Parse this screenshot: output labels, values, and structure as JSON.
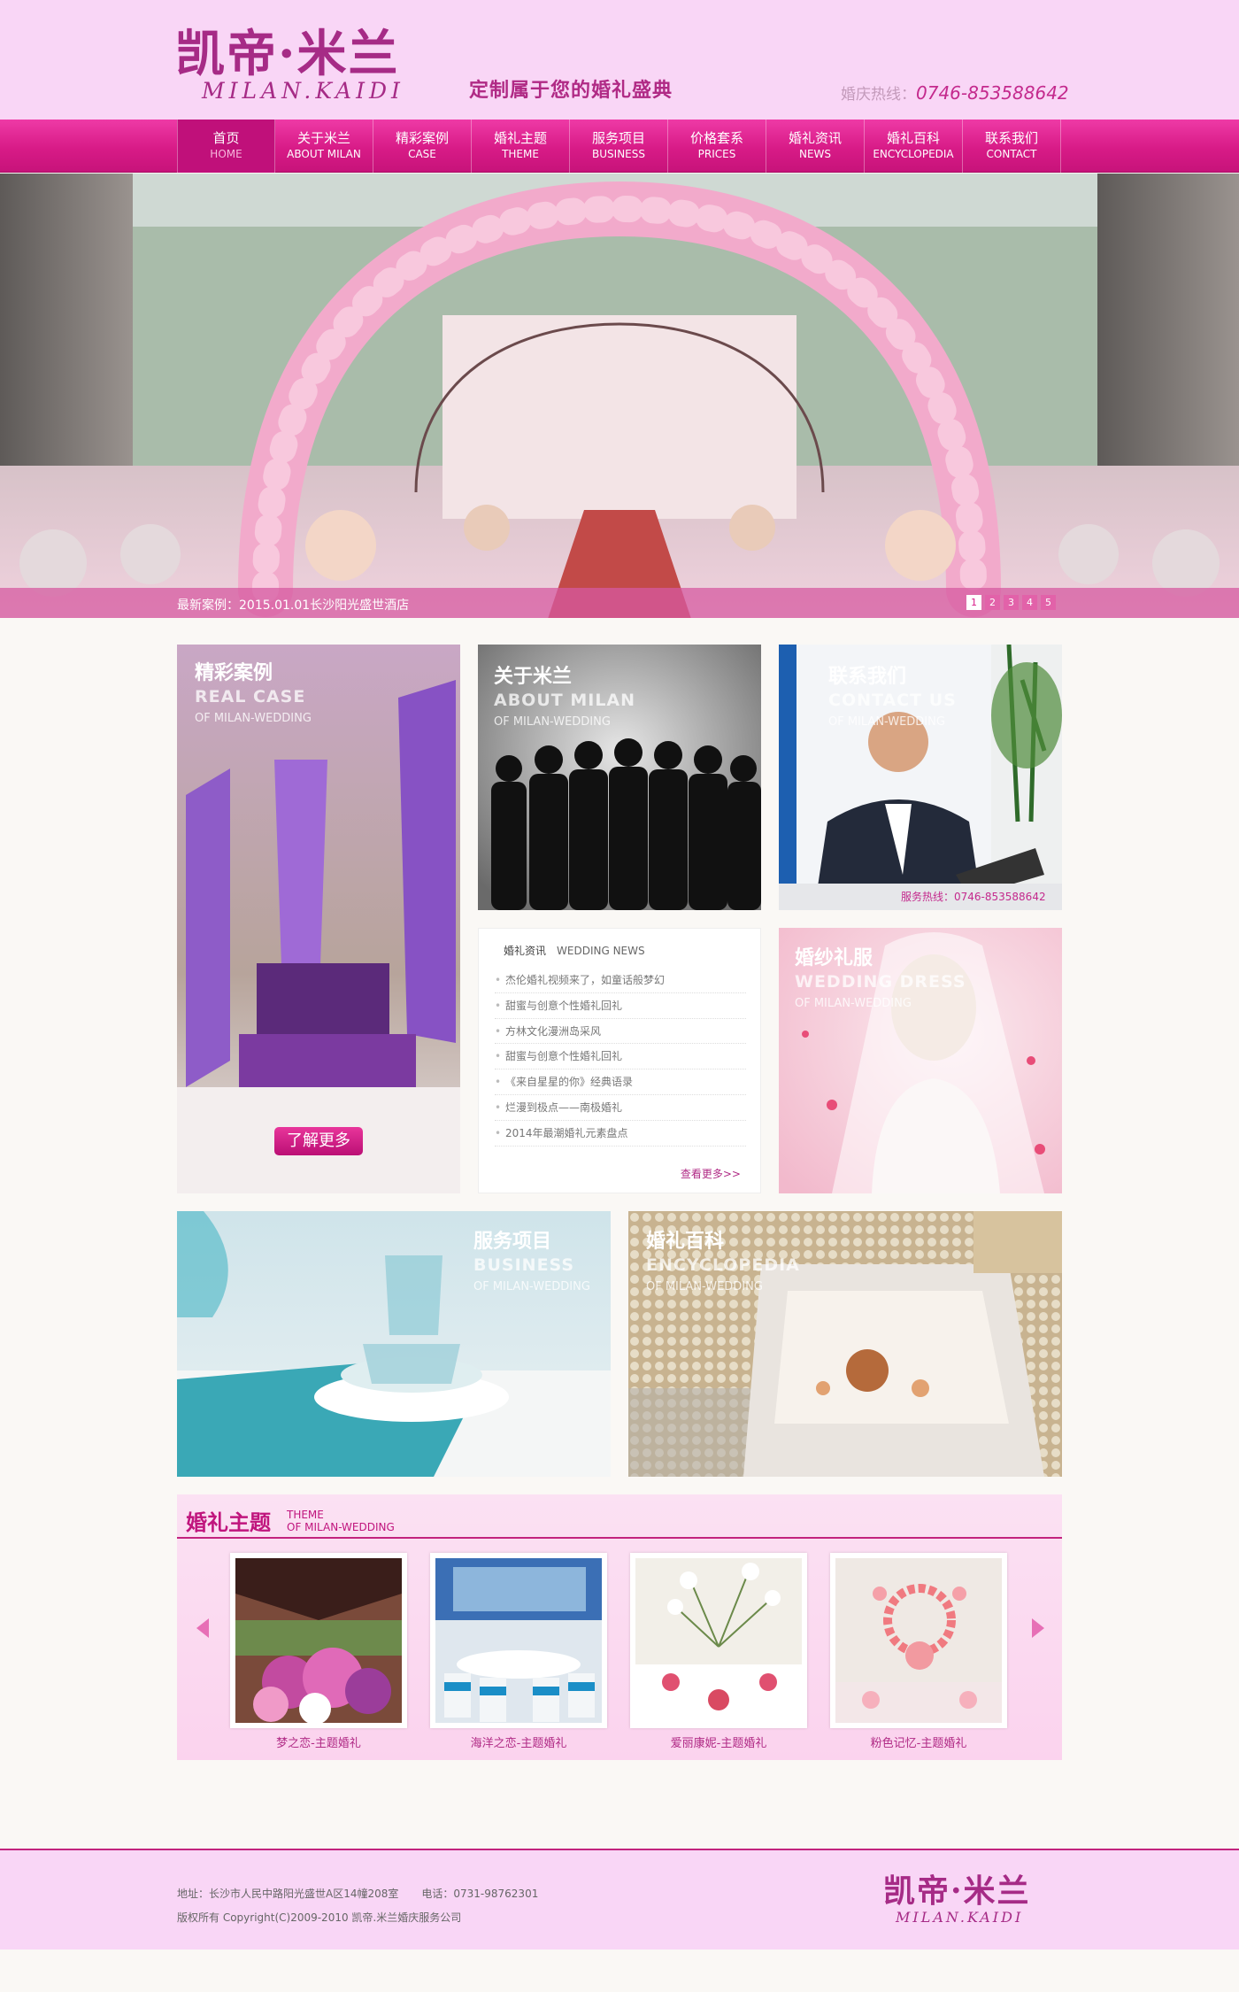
{
  "header": {
    "logo_cn": "凯帝·米兰",
    "logo_en": "MILAN.KAIDI",
    "slogan": "定制属于您的婚礼盛典",
    "hotline_label": "婚庆热线：",
    "hotline_number": "0746-853588642"
  },
  "nav": [
    {
      "cn": "首页",
      "en": "HOME"
    },
    {
      "cn": "关于米兰",
      "en": "ABOUT MILAN"
    },
    {
      "cn": "精彩案例",
      "en": "CASE"
    },
    {
      "cn": "婚礼主题",
      "en": "THEME"
    },
    {
      "cn": "服务项目",
      "en": "BUSINESS"
    },
    {
      "cn": "价格套系",
      "en": "PRICES"
    },
    {
      "cn": "婚礼资讯",
      "en": "NEWS"
    },
    {
      "cn": "婚礼百科",
      "en": "ENCYCLOPEDIA"
    },
    {
      "cn": "联系我们",
      "en": "CONTACT"
    }
  ],
  "hero": {
    "caption": "最新案例：2015.01.01长沙阳光盛世酒店",
    "pages": [
      "1",
      "2",
      "3",
      "4",
      "5"
    ]
  },
  "tiles": {
    "case": {
      "cn": "精彩案例",
      "en": "REAL CASE",
      "sub": "OF MILAN-WEDDING",
      "button": "了解更多"
    },
    "about": {
      "cn": "关于米兰",
      "en": "ABOUT MILAN",
      "sub": "OF MILAN-WEDDING"
    },
    "contact": {
      "cn": "联系我们",
      "en": "CONTACT US",
      "sub": "OF MILAN-WEDDING",
      "hotline": "服务热线：0746-853588642"
    },
    "dress": {
      "cn": "婚纱礼服",
      "en": "WEDDING DRESS",
      "sub": "OF MILAN-WEDDING"
    },
    "business": {
      "cn": "服务项目",
      "en": "BUSINESS",
      "sub": "OF MILAN-WEDDING"
    },
    "encyclopedia": {
      "cn": "婚礼百科",
      "en": "ENCYCLOPEDIA",
      "sub": "OF MILAN-WEDDING"
    }
  },
  "news": {
    "title_cn": "婚礼资讯",
    "title_en": "WEDDING NEWS",
    "items": [
      "杰伦婚礼视频来了，如童话般梦幻",
      "甜蜜与创意个性婚礼回礼",
      "方林文化漫洲岛采风",
      "甜蜜与创意个性婚礼回礼",
      "《来自星星的你》经典语录",
      "烂漫到极点——南极婚礼",
      "2014年最潮婚礼元素盘点"
    ],
    "more": "查看更多>>"
  },
  "theme": {
    "title_cn": "婚礼主题",
    "title_en_1": "THEME",
    "title_en_2": "OF MILAN-WEDDING",
    "items": [
      {
        "caption": "梦之恋-主题婚礼"
      },
      {
        "caption": "海洋之恋-主题婚礼"
      },
      {
        "caption": "爱丽康妮-主题婚礼"
      },
      {
        "caption": "粉色记忆-主题婚礼"
      }
    ]
  },
  "footer": {
    "address": "地址：长沙市人民中路阳光盛世A区14幢208室",
    "phone": "电话：0731-98762301",
    "copyright": "版权所有 Copyright(C)2009-2010 凯帝.米兰婚庆服务公司",
    "logo_cn": "凯帝·米兰",
    "logo_en": "MILAN.KAIDI"
  },
  "colors": {
    "brand": "#c42a8d",
    "nav_bg": "#d81b87",
    "header_bg": "#f9d6f6"
  }
}
